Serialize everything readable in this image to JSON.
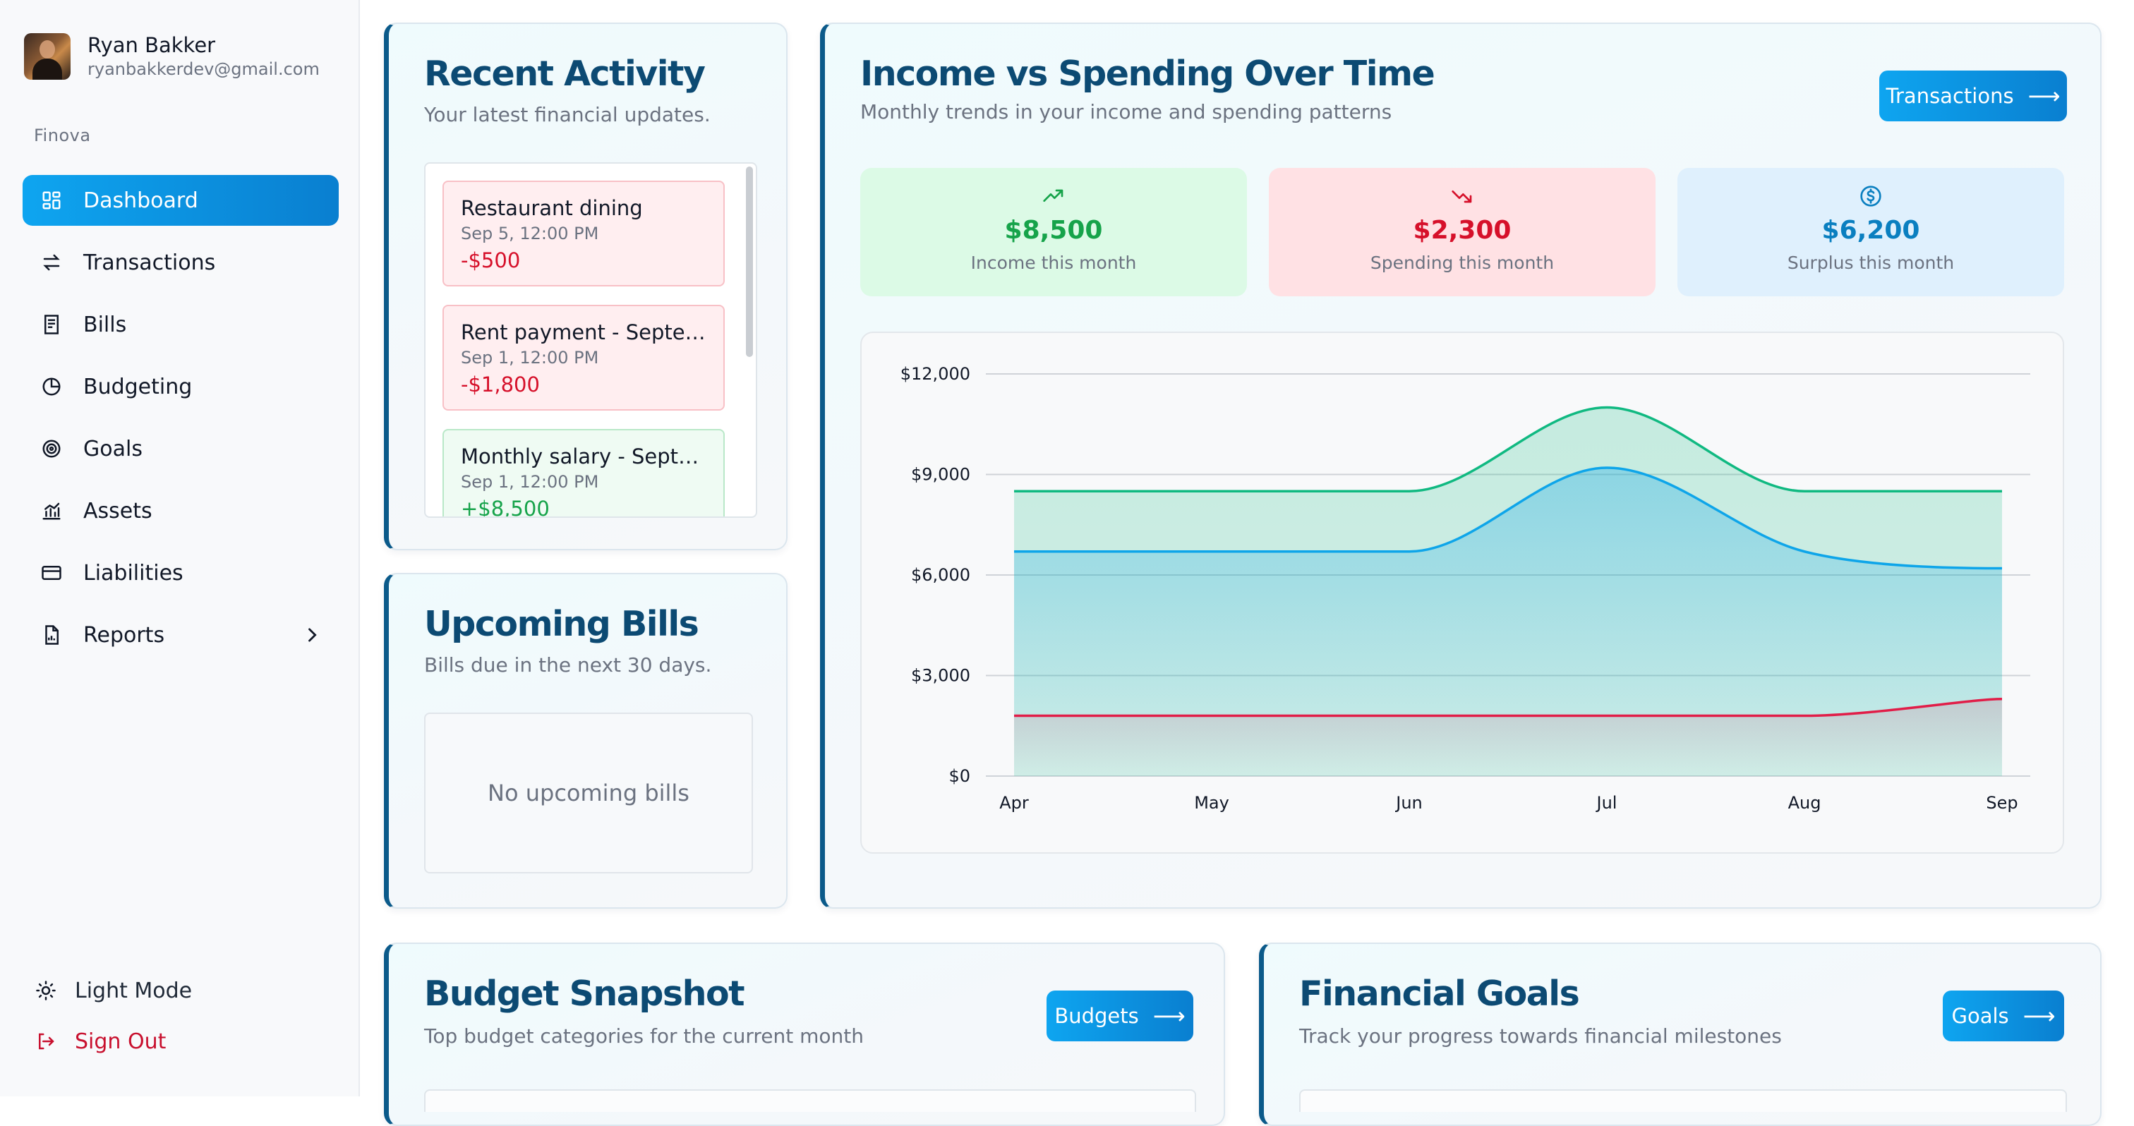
{
  "user": {
    "name": "Ryan Bakker",
    "email": "ryanbakkerdev@gmail.com"
  },
  "brand": "Finova",
  "nav": [
    {
      "label": "Dashboard",
      "icon": "grid-icon",
      "active": true
    },
    {
      "label": "Transactions",
      "icon": "arrows-swap-icon"
    },
    {
      "label": "Bills",
      "icon": "receipt-icon"
    },
    {
      "label": "Budgeting",
      "icon": "pie-chart-icon"
    },
    {
      "label": "Goals",
      "icon": "target-icon"
    },
    {
      "label": "Assets",
      "icon": "bar-chart-icon"
    },
    {
      "label": "Liabilities",
      "icon": "credit-card-icon"
    },
    {
      "label": "Reports",
      "icon": "file-chart-icon",
      "expandable": true
    }
  ],
  "bottom_nav": {
    "light_mode": "Light Mode",
    "sign_out": "Sign Out"
  },
  "recent_activity": {
    "title": "Recent Activity",
    "subtitle": "Your latest financial updates.",
    "items": [
      {
        "title": "Restaurant dining",
        "date": "Sep 5, 12:00 PM",
        "amount": "-$500",
        "type": "expense"
      },
      {
        "title": "Rent payment - Septem...",
        "date": "Sep 1, 12:00 PM",
        "amount": "-$1,800",
        "type": "expense"
      },
      {
        "title": "Monthly salary - Septe...",
        "date": "Sep 1, 12:00 PM",
        "amount": "+$8,500",
        "type": "income"
      }
    ]
  },
  "upcoming_bills": {
    "title": "Upcoming Bills",
    "subtitle": "Bills due in the next 30 days.",
    "empty_text": "No upcoming bills"
  },
  "income_spending": {
    "title": "Income vs Spending Over Time",
    "subtitle": "Monthly trends in your income and spending patterns",
    "button": "Transactions",
    "stats": {
      "income": {
        "value": "$8,500",
        "label": "Income this month"
      },
      "spending": {
        "value": "$2,300",
        "label": "Spending this month"
      },
      "surplus": {
        "value": "$6,200",
        "label": "Surplus this month"
      }
    }
  },
  "budget_snapshot": {
    "title": "Budget Snapshot",
    "subtitle": "Top budget categories for the current month",
    "button": "Budgets"
  },
  "financial_goals": {
    "title": "Financial Goals",
    "subtitle": "Track your progress towards financial milestones",
    "button": "Goals"
  },
  "colors": {
    "accent": "#0ea5f0",
    "title": "#0c4a73",
    "income": "#10b981",
    "surplus": "#0ea5e9",
    "spending": "#e11d48"
  },
  "chart_data": {
    "type": "area",
    "x": [
      "Apr",
      "May",
      "Jun",
      "Jul",
      "Aug",
      "Sep"
    ],
    "y_ticks": [
      "$0",
      "$3,000",
      "$6,000",
      "$9,000",
      "$12,000"
    ],
    "ylim": [
      0,
      12000
    ],
    "grid": true,
    "series": [
      {
        "color": "#10b981",
        "values": [
          8500,
          8500,
          8500,
          11000,
          8500,
          8500
        ]
      },
      {
        "color": "#0ea5e9",
        "values": [
          6700,
          6700,
          6700,
          9200,
          6700,
          6200
        ]
      },
      {
        "color": "#e11d48",
        "values": [
          1800,
          1800,
          1800,
          1800,
          1800,
          2300
        ]
      }
    ]
  }
}
